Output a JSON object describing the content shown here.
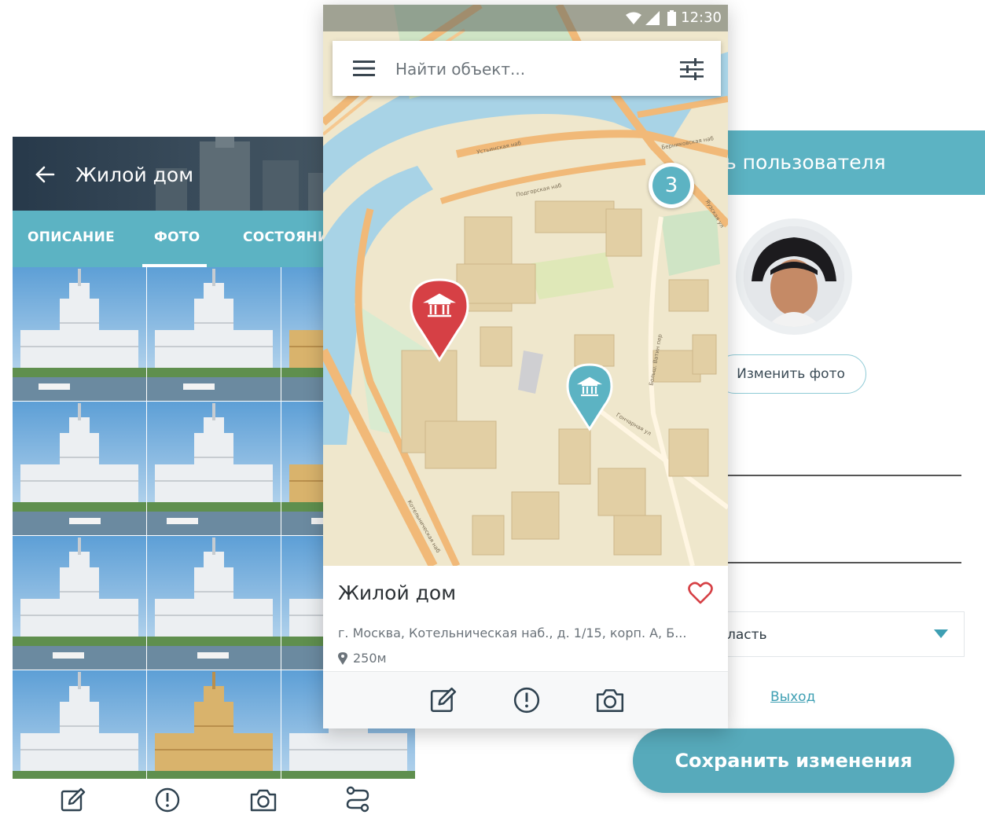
{
  "object_screen": {
    "title": "Жилой дом",
    "tabs": [
      {
        "label": "ОПИСАНИЕ"
      },
      {
        "label": "ФОТО",
        "active": true
      },
      {
        "label": "СОСТОЯНИЕ"
      }
    ],
    "bottom_actions": [
      "edit-icon",
      "alert-icon",
      "camera-icon",
      "route-icon"
    ]
  },
  "map_screen": {
    "status_time": "12:30",
    "search_placeholder": "Найти объект...",
    "cluster_count": "3",
    "street_labels": [
      "Устьинская наб",
      "Подгорская наб",
      "Берниковская наб",
      "Яузская ул",
      "Котельническая наб",
      "Гончарная ул",
      "Больш. Ватин пер"
    ],
    "card": {
      "title": "Жилой дом",
      "address": "г. Москва, Котельническая наб., д. 1/15, корп. А, Б...",
      "distance": "250м"
    },
    "actions": [
      "edit-icon",
      "alert-icon",
      "camera-icon"
    ]
  },
  "profile_screen": {
    "header_title": "ь пользователя",
    "change_photo_label": "Изменить фото",
    "field_partial_char": "|",
    "region_select_value": "ласть",
    "logout_label": "Выход",
    "save_label": "Сохранить изменения"
  },
  "colors": {
    "accent": "#5cb3c3",
    "accent_dark": "#3e9fb3",
    "pin_red": "#d64045",
    "pin_teal": "#5cb3c3",
    "heart": "#d64045"
  }
}
